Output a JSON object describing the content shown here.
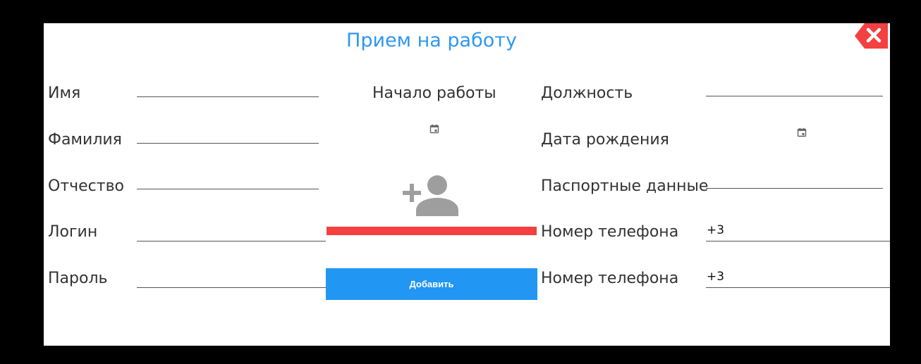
{
  "dialog": {
    "title": "Прием на работу",
    "close_icon": "close-icon"
  },
  "left_fields": [
    {
      "label": "Имя",
      "value": ""
    },
    {
      "label": "Фамилия",
      "value": ""
    },
    {
      "label": "Отчество",
      "value": ""
    },
    {
      "label": "Логин",
      "value": ""
    },
    {
      "label": "Пароль",
      "value": ""
    }
  ],
  "center": {
    "start_label": "Начало работы",
    "start_value": "",
    "calendar_icon": "calendar-icon",
    "photo_icon": "add-person-icon",
    "add_button": "Добавить"
  },
  "right_fields": {
    "position": {
      "label": "Должность",
      "value": ""
    },
    "birth_date": {
      "label": "Дата рождения",
      "value": ""
    },
    "passport": {
      "label": "Паспортные данные",
      "value": ""
    },
    "phone1": {
      "label": "Номер телефона",
      "value": "+3"
    },
    "phone2": {
      "label": "Номер телефона",
      "value": "+3"
    }
  },
  "colors": {
    "accent": "#2196f3",
    "title": "#2f97f0",
    "danger": "#f44040"
  }
}
